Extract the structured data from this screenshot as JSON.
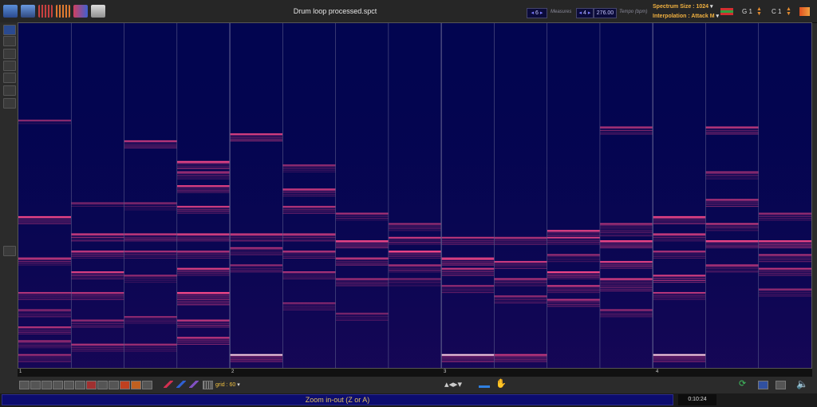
{
  "window": {
    "title": "Drum loop processed.spct"
  },
  "toolbar": {
    "measures_value": "6",
    "measures_label": "Measures",
    "beats_value": "4",
    "tempo_value": "276.00",
    "tempo_label": "Tempo (bpm)",
    "spectrum_size": "Spectrum Size : 1024",
    "interpolation": "Interpolation : Attack M",
    "g_label": "G 1",
    "c_label": "C 1"
  },
  "ruler": {
    "markers": [
      "1",
      "2",
      "3",
      "4"
    ]
  },
  "bottom": {
    "grid_label": "grid : 60"
  },
  "status": {
    "message": "Zoom in-out (Z or A)",
    "time": "0:10:24"
  },
  "colors": {
    "background": "#020550",
    "band": "#ff4a8a",
    "band_bright": "#ffd8e8",
    "accent": "#f0b040"
  },
  "spectrogram": {
    "columns": 15,
    "bands": [
      [
        [
          5.6,
          1,
          0.9
        ],
        [
          6.8,
          1,
          0.7
        ],
        [
          7.8,
          1,
          0.55
        ],
        [
          8.3,
          1,
          0.5
        ],
        [
          8.8,
          1,
          0.6
        ],
        [
          9.2,
          1,
          0.5
        ],
        [
          9.6,
          1,
          0.55
        ],
        [
          2.8,
          0.5,
          0.45
        ]
      ],
      [
        [
          6.1,
          1,
          0.8
        ],
        [
          6.6,
          1,
          0.65
        ],
        [
          7.2,
          1,
          0.8
        ],
        [
          7.8,
          1,
          0.6
        ],
        [
          8.6,
          1,
          0.5
        ],
        [
          9.3,
          1,
          0.55
        ],
        [
          5.2,
          0.5,
          0.4
        ]
      ],
      [
        [
          3.4,
          1,
          0.7
        ],
        [
          6.1,
          1,
          0.8
        ],
        [
          6.6,
          1,
          0.6
        ],
        [
          7.3,
          1,
          0.5
        ],
        [
          8.5,
          1,
          0.45
        ],
        [
          9.3,
          1,
          0.5
        ],
        [
          5.2,
          1,
          0.45
        ]
      ],
      [
        [
          4.0,
          1,
          0.9
        ],
        [
          4.3,
          1,
          0.6
        ],
        [
          4.7,
          1,
          0.8
        ],
        [
          5.3,
          1,
          0.7
        ],
        [
          6.1,
          1,
          0.9
        ],
        [
          6.6,
          1,
          0.6
        ],
        [
          7.1,
          1,
          0.8
        ],
        [
          7.8,
          1.5,
          0.9
        ],
        [
          8.6,
          1,
          0.7
        ],
        [
          9.1,
          1,
          0.6
        ]
      ],
      [
        [
          3.2,
          1,
          0.8
        ],
        [
          6.1,
          1,
          0.8
        ],
        [
          6.5,
          1,
          0.6
        ],
        [
          7.0,
          1,
          0.5
        ],
        [
          9.6,
          1,
          0.95
        ]
      ],
      [
        [
          4.1,
          1,
          0.5
        ],
        [
          4.8,
          1,
          0.7
        ],
        [
          5.3,
          1,
          0.6
        ],
        [
          6.1,
          1,
          0.75
        ],
        [
          6.6,
          1,
          0.6
        ],
        [
          7.2,
          1,
          0.55
        ],
        [
          8.1,
          1,
          0.4
        ]
      ],
      [
        [
          5.5,
          1,
          0.55
        ],
        [
          6.3,
          1,
          0.9
        ],
        [
          6.8,
          1,
          0.7
        ],
        [
          7.4,
          1,
          0.6
        ],
        [
          8.4,
          1,
          0.4
        ]
      ],
      [
        [
          5.8,
          1,
          0.55
        ],
        [
          6.2,
          1,
          0.7
        ],
        [
          6.6,
          1,
          0.9
        ],
        [
          7.0,
          1,
          0.6
        ],
        [
          7.4,
          1,
          0.4
        ]
      ],
      [
        [
          6.2,
          1,
          0.6
        ],
        [
          6.8,
          1,
          0.9
        ],
        [
          7.1,
          1,
          0.7
        ],
        [
          7.6,
          1,
          0.5
        ],
        [
          9.6,
          1,
          0.95
        ]
      ],
      [
        [
          6.2,
          1,
          0.6
        ],
        [
          6.9,
          1,
          0.7
        ],
        [
          7.4,
          1,
          0.6
        ],
        [
          7.9,
          1,
          0.5
        ],
        [
          9.6,
          1,
          0.7
        ]
      ],
      [
        [
          6.0,
          1,
          0.8
        ],
        [
          6.2,
          1,
          0.6
        ],
        [
          6.7,
          1,
          0.5
        ],
        [
          7.2,
          1,
          0.9
        ],
        [
          7.6,
          1,
          0.7
        ],
        [
          8.0,
          1,
          0.6
        ]
      ],
      [
        [
          3.0,
          1,
          0.6
        ],
        [
          5.8,
          1.5,
          0.6
        ],
        [
          6.3,
          1,
          0.9
        ],
        [
          6.9,
          1,
          0.8
        ],
        [
          7.4,
          1.5,
          0.85
        ],
        [
          8.3,
          1,
          0.5
        ]
      ],
      [
        [
          5.6,
          1,
          0.85
        ],
        [
          6.1,
          1,
          0.8
        ],
        [
          6.6,
          1,
          0.6
        ],
        [
          7.3,
          1,
          0.8
        ],
        [
          7.8,
          1,
          0.6
        ],
        [
          9.6,
          1,
          0.95
        ]
      ],
      [
        [
          3.0,
          1,
          0.7
        ],
        [
          4.3,
          1,
          0.5
        ],
        [
          5.1,
          1,
          0.6
        ],
        [
          5.8,
          1,
          0.7
        ],
        [
          6.3,
          1,
          0.9
        ],
        [
          7.0,
          1,
          0.6
        ]
      ],
      [
        [
          5.5,
          1,
          0.5
        ],
        [
          6.3,
          1,
          0.9
        ],
        [
          6.7,
          1,
          0.6
        ],
        [
          7.1,
          1,
          0.6
        ],
        [
          7.7,
          1,
          0.5
        ]
      ]
    ]
  }
}
